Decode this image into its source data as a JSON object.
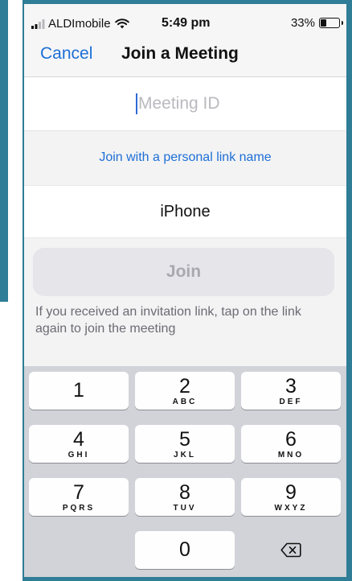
{
  "status_bar": {
    "carrier": "ALDImobile",
    "time": "5:49 pm",
    "battery": "33%",
    "battery_level": 0.33
  },
  "nav": {
    "cancel_label": "Cancel",
    "title": "Join a Meeting"
  },
  "meeting_id": {
    "value": "",
    "placeholder": "Meeting ID"
  },
  "personal_link_label": "Join with a personal link name",
  "name_field": {
    "value": "iPhone"
  },
  "join_button_label": "Join",
  "hint_text": "If you received an invitation link, tap on the link again to join the meeting",
  "keypad": {
    "keys": [
      {
        "number": "1",
        "letters": ""
      },
      {
        "number": "2",
        "letters": "ABC"
      },
      {
        "number": "3",
        "letters": "DEF"
      },
      {
        "number": "4",
        "letters": "GHI"
      },
      {
        "number": "5",
        "letters": "JKL"
      },
      {
        "number": "6",
        "letters": "MNO"
      },
      {
        "number": "7",
        "letters": "PQRS"
      },
      {
        "number": "8",
        "letters": "TUV"
      },
      {
        "number": "9",
        "letters": "WXYZ"
      },
      {
        "number": "0",
        "letters": ""
      }
    ],
    "delete_icon": "backspace-icon"
  },
  "colors": {
    "accent": "#1d6fd6",
    "frame": "#2f7d96",
    "join_disabled_bg": "#e5e5ea",
    "join_disabled_text": "#a8a8ae"
  }
}
